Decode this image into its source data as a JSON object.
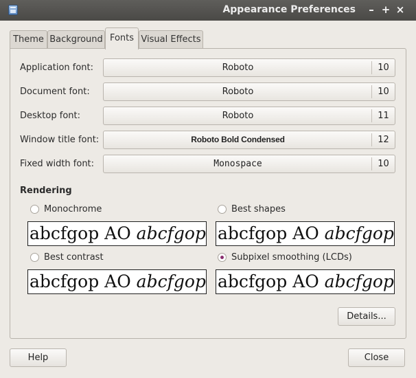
{
  "window": {
    "title": "Appearance Preferences",
    "controls": {
      "minimize": "–",
      "maximize": "+",
      "close": "×"
    }
  },
  "tabs": [
    {
      "label": "Theme"
    },
    {
      "label": "Background"
    },
    {
      "label": "Fonts",
      "active": true
    },
    {
      "label": "Visual Effects"
    }
  ],
  "fonts": [
    {
      "label": "Application font:",
      "font": "Roboto",
      "size": "10"
    },
    {
      "label": "Document font:",
      "font": "Roboto",
      "size": "10"
    },
    {
      "label": "Desktop font:",
      "font": "Roboto",
      "size": "11"
    },
    {
      "label": "Window title font:",
      "font": "Roboto Bold Condensed",
      "size": "12"
    },
    {
      "label": "Fixed width font:",
      "font": "Monospace",
      "size": "10"
    }
  ],
  "rendering": {
    "title": "Rendering",
    "sample_text": "abcfgop AO ",
    "sample_italic": "abcfgop",
    "options": [
      {
        "label": "Monochrome",
        "checked": false
      },
      {
        "label": "Best shapes",
        "checked": false
      },
      {
        "label": "Best contrast",
        "checked": false
      },
      {
        "label": "Subpixel smoothing (LCDs)",
        "checked": true
      }
    ]
  },
  "buttons": {
    "details": "Details...",
    "help": "Help",
    "close": "Close"
  },
  "colors": {
    "window_bg": "#edeae5",
    "titlebar": "#4f4e4b",
    "radio_accent": "#8a2f6f"
  }
}
